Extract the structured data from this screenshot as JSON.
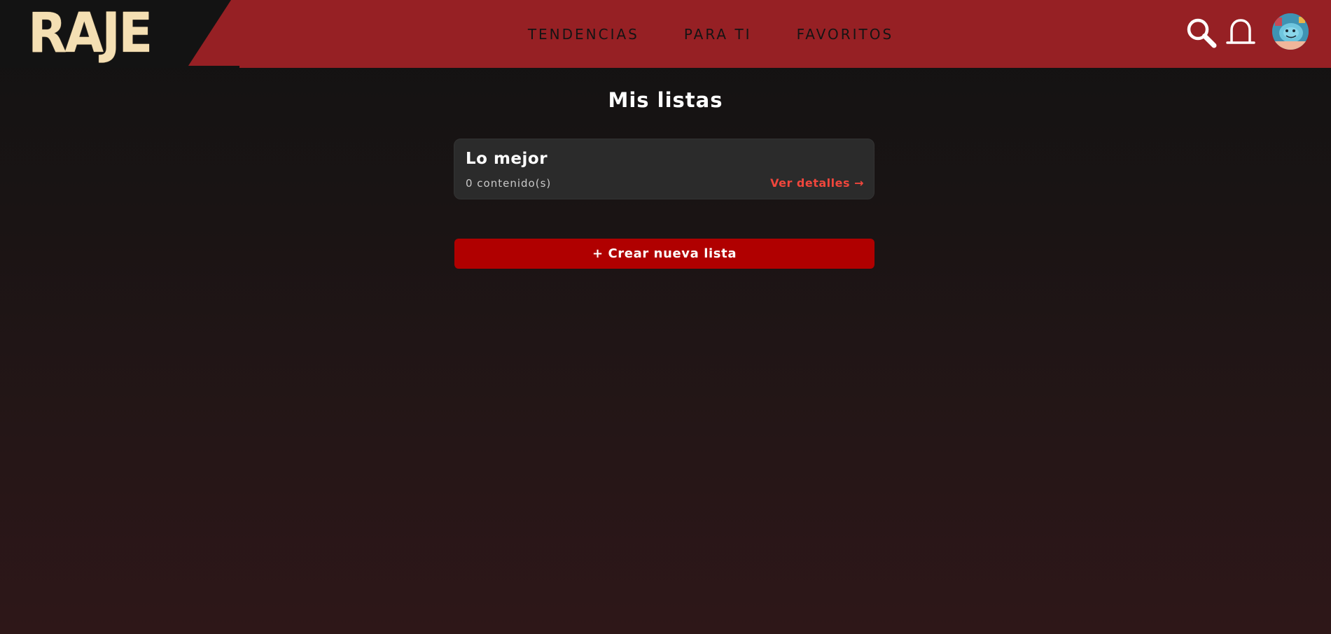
{
  "app": {
    "logo_text": "RAJE"
  },
  "nav": {
    "items": [
      {
        "label": "TENDENCIAS"
      },
      {
        "label": "PARA TI"
      },
      {
        "label": "FAVORITOS"
      }
    ]
  },
  "header_icons": {
    "search": "search-icon",
    "notifications": "bell-icon",
    "avatar": "user-avatar"
  },
  "main": {
    "title": "Mis listas",
    "lists": [
      {
        "name": "Lo mejor",
        "count_text": "0 contenido(s)",
        "link_text": "Ver detalles →"
      }
    ],
    "create_button": "+ Crear nueva lista"
  },
  "colors": {
    "header_bg": "#962024",
    "logo_bg": "#131313",
    "logo_text": "#f4dfb3",
    "accent_button": "#b00000",
    "link": "#f0463c",
    "card_bg": "#2b2b2b"
  }
}
